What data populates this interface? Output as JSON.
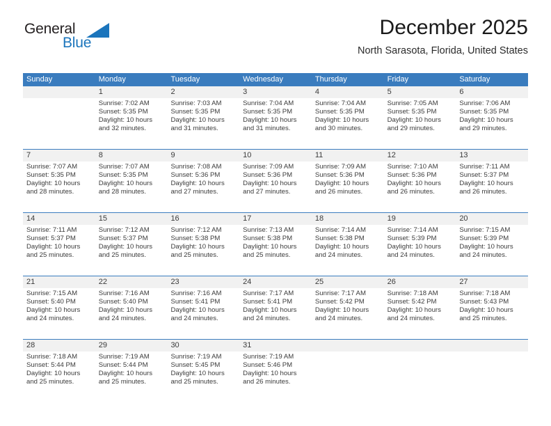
{
  "brand": {
    "name_part1": "General",
    "name_part2": "Blue",
    "mark": "triangle-logo-icon",
    "color": "#1b75bc"
  },
  "header": {
    "title": "December 2025",
    "location": "North Sarasota, Florida, United States"
  },
  "theme": {
    "header_bg": "#3a7cbe",
    "daynum_strip_bg": "#f1f1f1",
    "text": "#3b3b3b",
    "page_bg": "#ffffff"
  },
  "weekdays": [
    "Sunday",
    "Monday",
    "Tuesday",
    "Wednesday",
    "Thursday",
    "Friday",
    "Saturday"
  ],
  "weeks": [
    {
      "days": [
        {
          "day": "",
          "sunrise": "",
          "sunset": "",
          "daylight_line1": "",
          "daylight_line2": "",
          "empty": true
        },
        {
          "day": "1",
          "sunrise": "Sunrise: 7:02 AM",
          "sunset": "Sunset: 5:35 PM",
          "daylight_line1": "Daylight: 10 hours",
          "daylight_line2": "and 32 minutes.",
          "empty": false
        },
        {
          "day": "2",
          "sunrise": "Sunrise: 7:03 AM",
          "sunset": "Sunset: 5:35 PM",
          "daylight_line1": "Daylight: 10 hours",
          "daylight_line2": "and 31 minutes.",
          "empty": false
        },
        {
          "day": "3",
          "sunrise": "Sunrise: 7:04 AM",
          "sunset": "Sunset: 5:35 PM",
          "daylight_line1": "Daylight: 10 hours",
          "daylight_line2": "and 31 minutes.",
          "empty": false
        },
        {
          "day": "4",
          "sunrise": "Sunrise: 7:04 AM",
          "sunset": "Sunset: 5:35 PM",
          "daylight_line1": "Daylight: 10 hours",
          "daylight_line2": "and 30 minutes.",
          "empty": false
        },
        {
          "day": "5",
          "sunrise": "Sunrise: 7:05 AM",
          "sunset": "Sunset: 5:35 PM",
          "daylight_line1": "Daylight: 10 hours",
          "daylight_line2": "and 29 minutes.",
          "empty": false
        },
        {
          "day": "6",
          "sunrise": "Sunrise: 7:06 AM",
          "sunset": "Sunset: 5:35 PM",
          "daylight_line1": "Daylight: 10 hours",
          "daylight_line2": "and 29 minutes.",
          "empty": false
        }
      ]
    },
    {
      "days": [
        {
          "day": "7",
          "sunrise": "Sunrise: 7:07 AM",
          "sunset": "Sunset: 5:35 PM",
          "daylight_line1": "Daylight: 10 hours",
          "daylight_line2": "and 28 minutes.",
          "empty": false
        },
        {
          "day": "8",
          "sunrise": "Sunrise: 7:07 AM",
          "sunset": "Sunset: 5:35 PM",
          "daylight_line1": "Daylight: 10 hours",
          "daylight_line2": "and 28 minutes.",
          "empty": false
        },
        {
          "day": "9",
          "sunrise": "Sunrise: 7:08 AM",
          "sunset": "Sunset: 5:36 PM",
          "daylight_line1": "Daylight: 10 hours",
          "daylight_line2": "and 27 minutes.",
          "empty": false
        },
        {
          "day": "10",
          "sunrise": "Sunrise: 7:09 AM",
          "sunset": "Sunset: 5:36 PM",
          "daylight_line1": "Daylight: 10 hours",
          "daylight_line2": "and 27 minutes.",
          "empty": false
        },
        {
          "day": "11",
          "sunrise": "Sunrise: 7:09 AM",
          "sunset": "Sunset: 5:36 PM",
          "daylight_line1": "Daylight: 10 hours",
          "daylight_line2": "and 26 minutes.",
          "empty": false
        },
        {
          "day": "12",
          "sunrise": "Sunrise: 7:10 AM",
          "sunset": "Sunset: 5:36 PM",
          "daylight_line1": "Daylight: 10 hours",
          "daylight_line2": "and 26 minutes.",
          "empty": false
        },
        {
          "day": "13",
          "sunrise": "Sunrise: 7:11 AM",
          "sunset": "Sunset: 5:37 PM",
          "daylight_line1": "Daylight: 10 hours",
          "daylight_line2": "and 26 minutes.",
          "empty": false
        }
      ]
    },
    {
      "days": [
        {
          "day": "14",
          "sunrise": "Sunrise: 7:11 AM",
          "sunset": "Sunset: 5:37 PM",
          "daylight_line1": "Daylight: 10 hours",
          "daylight_line2": "and 25 minutes.",
          "empty": false
        },
        {
          "day": "15",
          "sunrise": "Sunrise: 7:12 AM",
          "sunset": "Sunset: 5:37 PM",
          "daylight_line1": "Daylight: 10 hours",
          "daylight_line2": "and 25 minutes.",
          "empty": false
        },
        {
          "day": "16",
          "sunrise": "Sunrise: 7:12 AM",
          "sunset": "Sunset: 5:38 PM",
          "daylight_line1": "Daylight: 10 hours",
          "daylight_line2": "and 25 minutes.",
          "empty": false
        },
        {
          "day": "17",
          "sunrise": "Sunrise: 7:13 AM",
          "sunset": "Sunset: 5:38 PM",
          "daylight_line1": "Daylight: 10 hours",
          "daylight_line2": "and 25 minutes.",
          "empty": false
        },
        {
          "day": "18",
          "sunrise": "Sunrise: 7:14 AM",
          "sunset": "Sunset: 5:38 PM",
          "daylight_line1": "Daylight: 10 hours",
          "daylight_line2": "and 24 minutes.",
          "empty": false
        },
        {
          "day": "19",
          "sunrise": "Sunrise: 7:14 AM",
          "sunset": "Sunset: 5:39 PM",
          "daylight_line1": "Daylight: 10 hours",
          "daylight_line2": "and 24 minutes.",
          "empty": false
        },
        {
          "day": "20",
          "sunrise": "Sunrise: 7:15 AM",
          "sunset": "Sunset: 5:39 PM",
          "daylight_line1": "Daylight: 10 hours",
          "daylight_line2": "and 24 minutes.",
          "empty": false
        }
      ]
    },
    {
      "days": [
        {
          "day": "21",
          "sunrise": "Sunrise: 7:15 AM",
          "sunset": "Sunset: 5:40 PM",
          "daylight_line1": "Daylight: 10 hours",
          "daylight_line2": "and 24 minutes.",
          "empty": false
        },
        {
          "day": "22",
          "sunrise": "Sunrise: 7:16 AM",
          "sunset": "Sunset: 5:40 PM",
          "daylight_line1": "Daylight: 10 hours",
          "daylight_line2": "and 24 minutes.",
          "empty": false
        },
        {
          "day": "23",
          "sunrise": "Sunrise: 7:16 AM",
          "sunset": "Sunset: 5:41 PM",
          "daylight_line1": "Daylight: 10 hours",
          "daylight_line2": "and 24 minutes.",
          "empty": false
        },
        {
          "day": "24",
          "sunrise": "Sunrise: 7:17 AM",
          "sunset": "Sunset: 5:41 PM",
          "daylight_line1": "Daylight: 10 hours",
          "daylight_line2": "and 24 minutes.",
          "empty": false
        },
        {
          "day": "25",
          "sunrise": "Sunrise: 7:17 AM",
          "sunset": "Sunset: 5:42 PM",
          "daylight_line1": "Daylight: 10 hours",
          "daylight_line2": "and 24 minutes.",
          "empty": false
        },
        {
          "day": "26",
          "sunrise": "Sunrise: 7:18 AM",
          "sunset": "Sunset: 5:42 PM",
          "daylight_line1": "Daylight: 10 hours",
          "daylight_line2": "and 24 minutes.",
          "empty": false
        },
        {
          "day": "27",
          "sunrise": "Sunrise: 7:18 AM",
          "sunset": "Sunset: 5:43 PM",
          "daylight_line1": "Daylight: 10 hours",
          "daylight_line2": "and 25 minutes.",
          "empty": false
        }
      ]
    },
    {
      "days": [
        {
          "day": "28",
          "sunrise": "Sunrise: 7:18 AM",
          "sunset": "Sunset: 5:44 PM",
          "daylight_line1": "Daylight: 10 hours",
          "daylight_line2": "and 25 minutes.",
          "empty": false
        },
        {
          "day": "29",
          "sunrise": "Sunrise: 7:19 AM",
          "sunset": "Sunset: 5:44 PM",
          "daylight_line1": "Daylight: 10 hours",
          "daylight_line2": "and 25 minutes.",
          "empty": false
        },
        {
          "day": "30",
          "sunrise": "Sunrise: 7:19 AM",
          "sunset": "Sunset: 5:45 PM",
          "daylight_line1": "Daylight: 10 hours",
          "daylight_line2": "and 25 minutes.",
          "empty": false
        },
        {
          "day": "31",
          "sunrise": "Sunrise: 7:19 AM",
          "sunset": "Sunset: 5:46 PM",
          "daylight_line1": "Daylight: 10 hours",
          "daylight_line2": "and 26 minutes.",
          "empty": false
        },
        {
          "day": "",
          "sunrise": "",
          "sunset": "",
          "daylight_line1": "",
          "daylight_line2": "",
          "empty": true
        },
        {
          "day": "",
          "sunrise": "",
          "sunset": "",
          "daylight_line1": "",
          "daylight_line2": "",
          "empty": true
        },
        {
          "day": "",
          "sunrise": "",
          "sunset": "",
          "daylight_line1": "",
          "daylight_line2": "",
          "empty": true
        }
      ]
    }
  ]
}
